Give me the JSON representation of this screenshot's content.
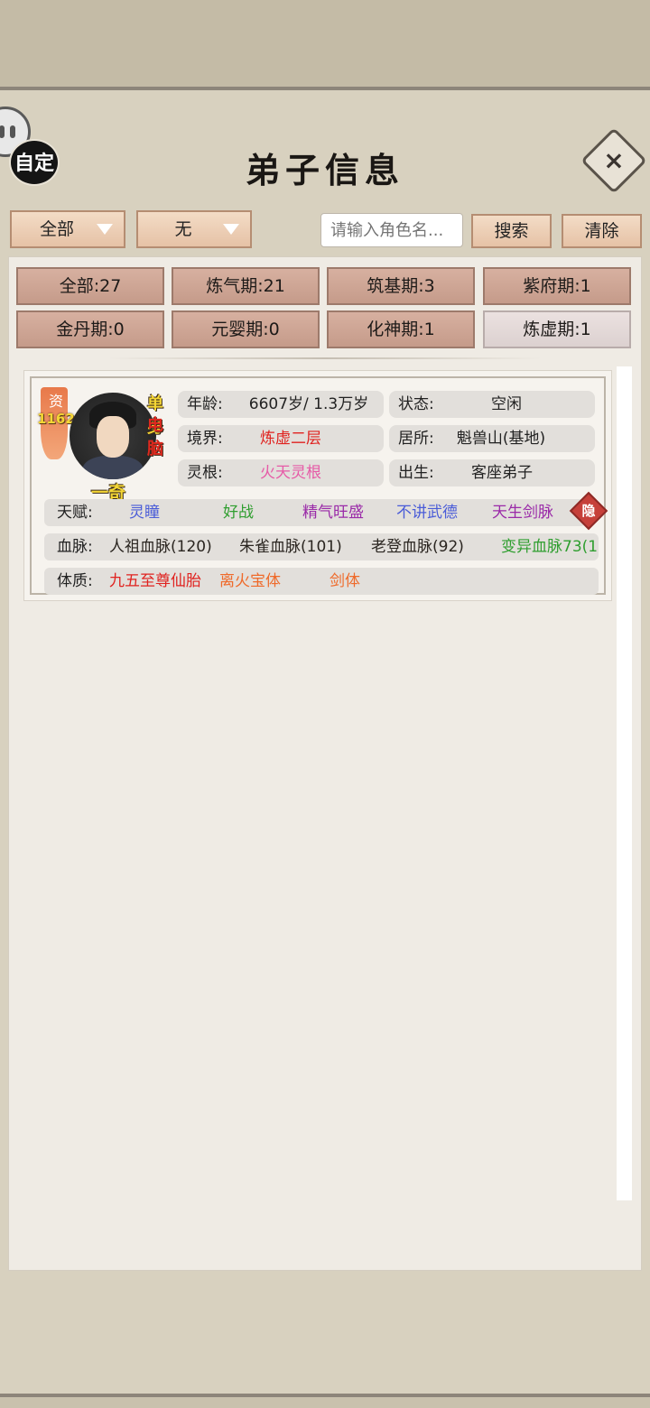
{
  "header": {
    "title": "弟子信息",
    "custom_button_label": "自定",
    "close_icon": "×"
  },
  "filters": {
    "category_dropdown": "全部",
    "sub_dropdown": "无",
    "search_placeholder": "请输入角色名...",
    "search_button": "搜索",
    "clear_button": "清除"
  },
  "realm_tabs": [
    {
      "label": "全部:27"
    },
    {
      "label": "炼气期:21"
    },
    {
      "label": "筑基期:3"
    },
    {
      "label": "紫府期:1"
    },
    {
      "label": "金丹期:0"
    },
    {
      "label": "元婴期:0"
    },
    {
      "label": "化神期:1"
    },
    {
      "label": "炼虚期:1"
    }
  ],
  "disciple": {
    "aptitude_label": "资",
    "aptitude_value": "1162",
    "tag_single": "单身",
    "tag_pc": "电脑",
    "name": "一奇",
    "age_key": "年龄:",
    "age_value": "6607岁/ 1.3万岁",
    "status_key": "状态:",
    "status_value": "空闲",
    "realm_key": "境界:",
    "realm_value": "炼虚二层",
    "residence_key": "居所:",
    "residence_value": "魁兽山(基地)",
    "root_key": "灵根:",
    "root_value": "火天灵根",
    "origin_key": "出生:",
    "origin_value": "客座弟子",
    "talent_key": "天赋:",
    "talents": [
      "灵瞳",
      "好战",
      "精气旺盛",
      "不讲武德",
      "天生剑脉"
    ],
    "hidden_badge": "隐",
    "bloodline_key": "血脉:",
    "bloodlines": [
      "人祖血脉(120)",
      "朱雀血脉(101)",
      "老登血脉(92)",
      "变异血脉73(1"
    ],
    "physique_key": "体质:",
    "physiques": [
      "九五至尊仙胎",
      "离火宝体",
      "剑体"
    ]
  },
  "colors": {
    "realm_value": "#e0221f",
    "root_value": "#e65ba7",
    "talent_blue": "#4a5cd8",
    "talent_green": "#2f9e2f",
    "talent_purple": "#9a2aa8",
    "bloodline_green": "#2f9e2f",
    "physique_red": "#e0221f",
    "physique_orange": "#ef6a2a"
  }
}
